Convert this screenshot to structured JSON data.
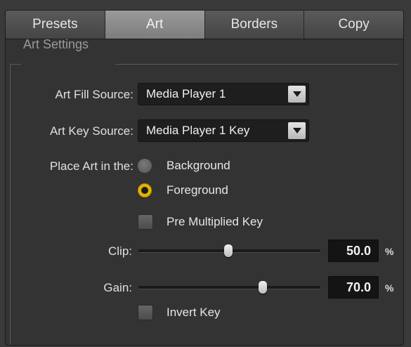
{
  "tabs": [
    {
      "label": "Presets",
      "active": false
    },
    {
      "label": "Art",
      "active": true
    },
    {
      "label": "Borders",
      "active": false
    },
    {
      "label": "Copy",
      "active": false
    }
  ],
  "art_settings": {
    "title": "Art Settings",
    "fill_source": {
      "label": "Art Fill Source:",
      "value": "Media Player 1"
    },
    "key_source": {
      "label": "Art Key Source:",
      "value": "Media Player 1 Key"
    },
    "place": {
      "label": "Place Art in the:",
      "options": [
        {
          "label": "Background",
          "selected": false
        },
        {
          "label": "Foreground",
          "selected": true
        }
      ]
    },
    "pre_multiplied": {
      "label": "Pre Multiplied Key",
      "checked": false
    },
    "clip": {
      "label": "Clip:",
      "value": "50.0",
      "unit": "%"
    },
    "gain": {
      "label": "Gain:",
      "value": "70.0",
      "unit": "%"
    },
    "invert_key": {
      "label": "Invert Key",
      "checked": false
    }
  },
  "colors": {
    "accent": "#e3b400"
  }
}
